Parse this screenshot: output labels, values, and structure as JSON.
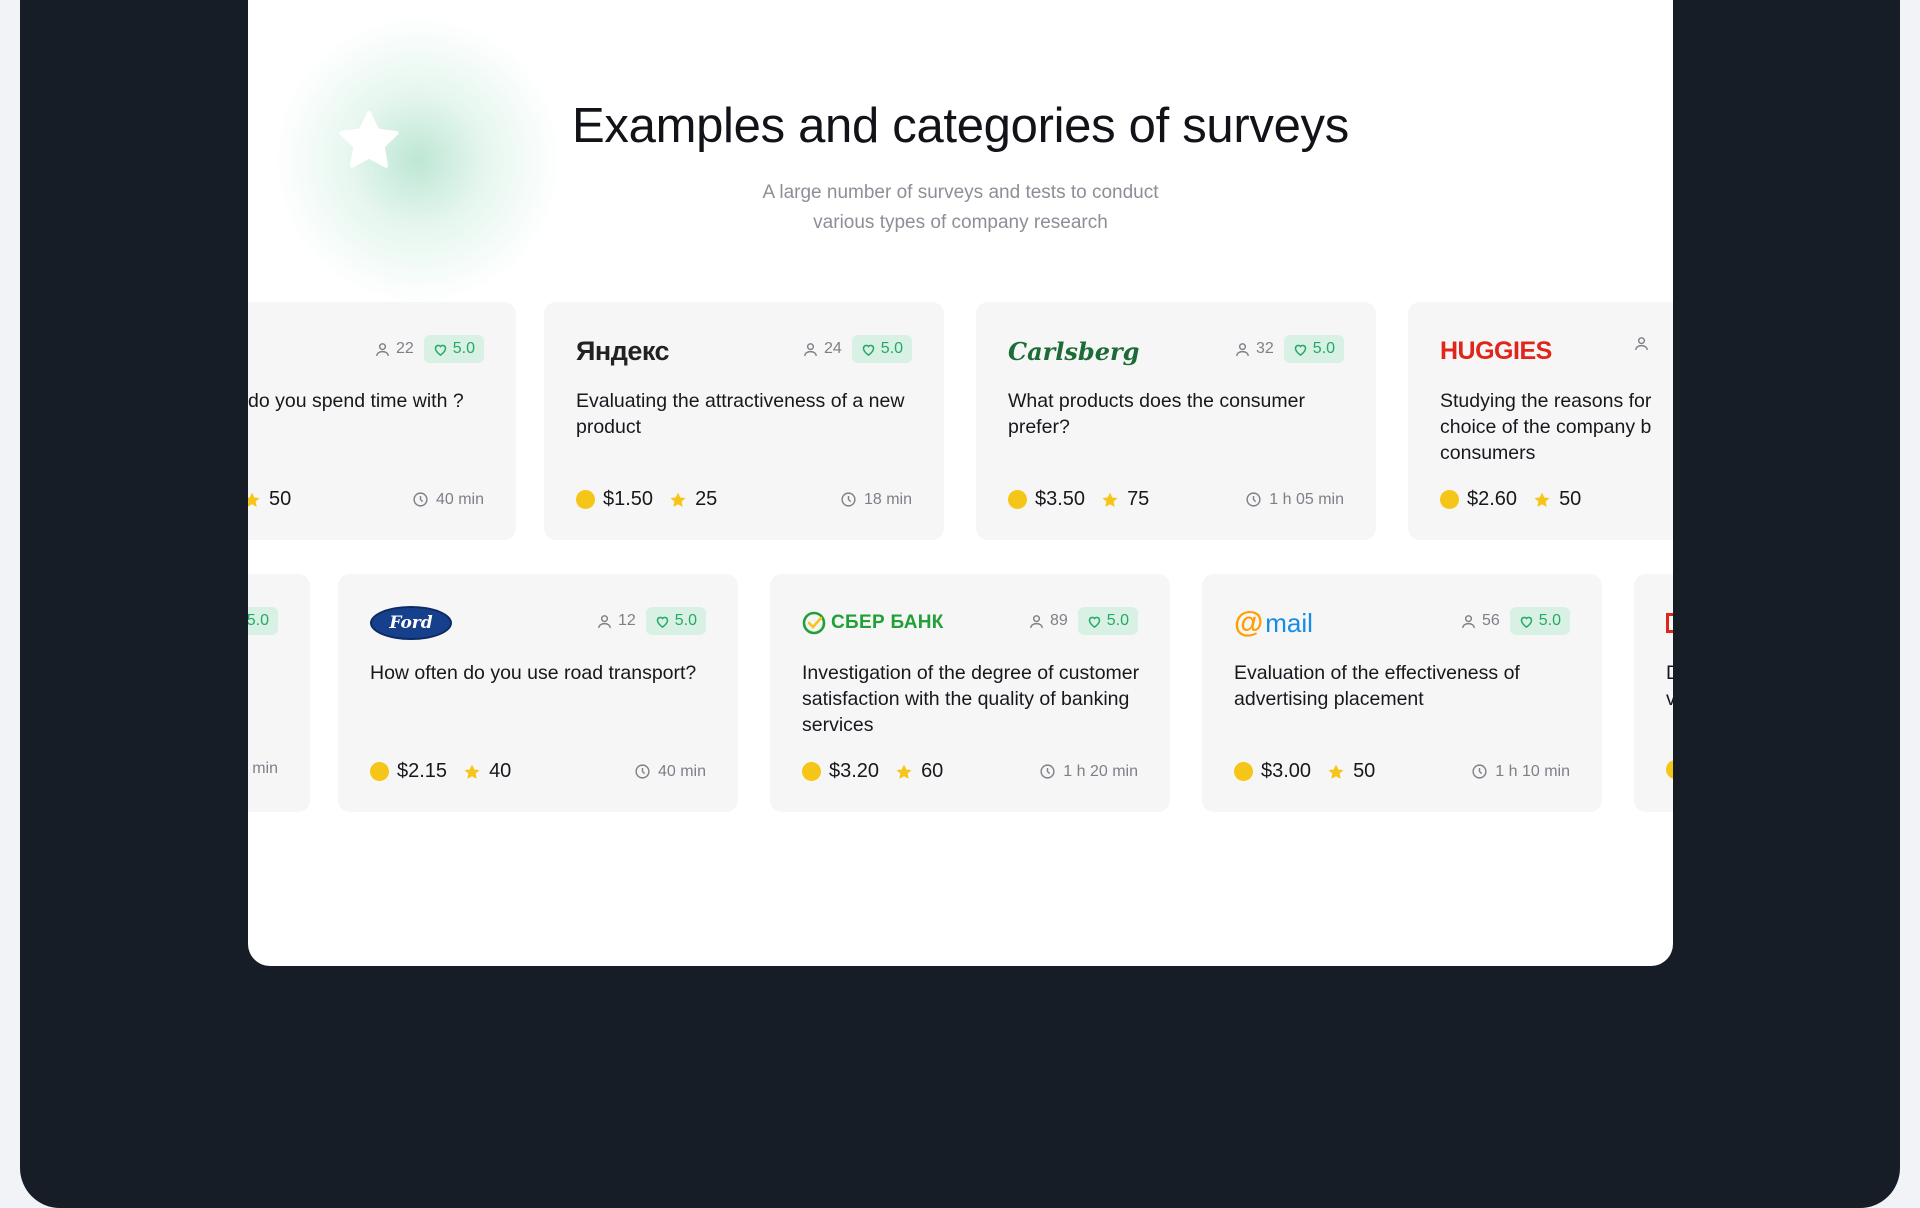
{
  "section": {
    "title": "Examples and categories of surveys",
    "subtitle_line1": "A large number of surveys and tests to conduct",
    "subtitle_line2": "various types of company research"
  },
  "colors": {
    "rating_bg": "#d8f1e4",
    "rating_text": "#25a968",
    "coin": "#f5c518",
    "star": "#f5c518",
    "panel": "#ffffff",
    "frame": "#171d27"
  },
  "row1": [
    {
      "brand": "",
      "respondents": "22",
      "rating": "5.0",
      "question": "do you spend time with ?",
      "price": "",
      "points": "50",
      "time": "40 min"
    },
    {
      "brand": "Яндекс",
      "respondents": "24",
      "rating": "5.0",
      "question": "Evaluating the attractiveness of a new product",
      "price": "$1.50",
      "points": "25",
      "time": "18 min"
    },
    {
      "brand": "Carlsberg",
      "respondents": "32",
      "rating": "5.0",
      "question": "What products does the consumer prefer?",
      "price": "$3.50",
      "points": "75",
      "time": "1 h 05 min"
    },
    {
      "brand": "HUGGIES",
      "respondents": "",
      "rating": "",
      "question": "Studying the reasons for choice of the company b consumers",
      "price": "$2.60",
      "points": "50",
      "time": ""
    }
  ],
  "row2": [
    {
      "brand": "",
      "respondents": "",
      "rating": "5.0",
      "question": "",
      "price": "",
      "points": "",
      "time": "min"
    },
    {
      "brand": "Ford",
      "respondents": "12",
      "rating": "5.0",
      "question": "How often do you use road transport?",
      "price": "$2.15",
      "points": "40",
      "time": "40 min"
    },
    {
      "brand": "СБЕР БАНК",
      "respondents": "89",
      "rating": "5.0",
      "question": "Investigation of the degree of customer satisfaction with the quality of banking services",
      "price": "$3.20",
      "points": "60",
      "time": "1 h 20 min"
    },
    {
      "brand": "mail",
      "respondents": "56",
      "rating": "5.0",
      "question": "Evaluation of the effectiveness of advertising placement",
      "price": "$3.00",
      "points": "50",
      "time": "1 h 10 min"
    },
    {
      "brand": "",
      "respondents": "",
      "rating": "",
      "question": "D v",
      "price": "",
      "points": "",
      "time": ""
    }
  ]
}
